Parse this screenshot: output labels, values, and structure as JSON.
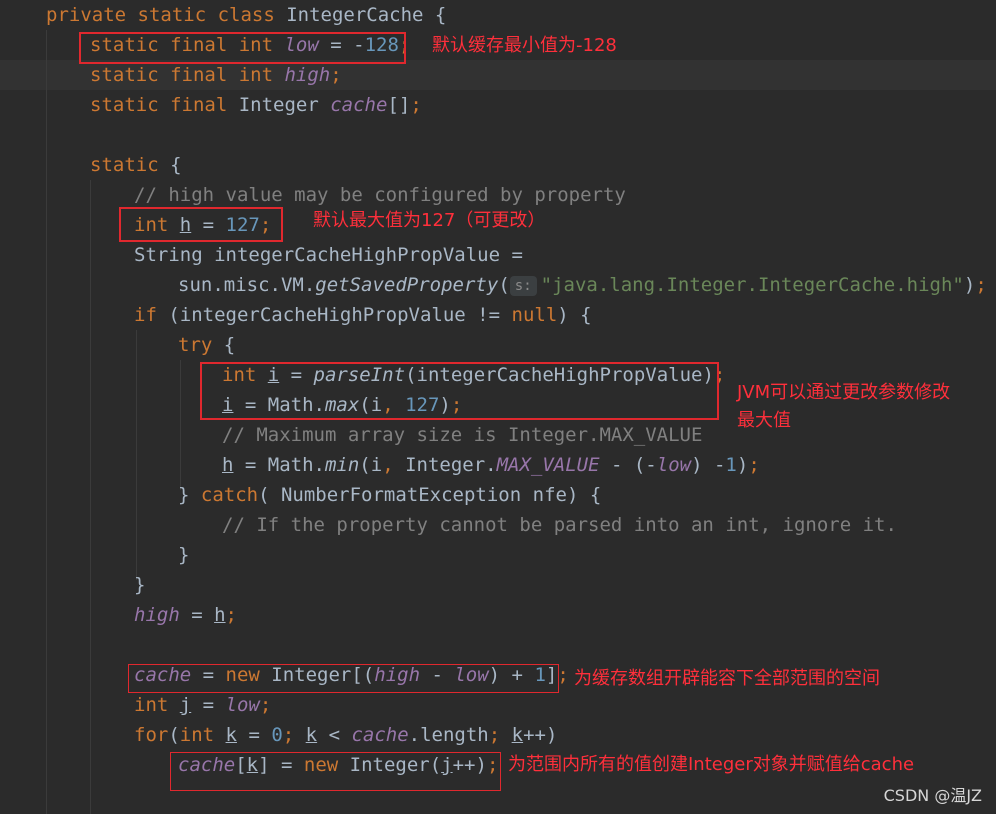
{
  "code": {
    "l1": {
      "kw": "private static class ",
      "cls": "IntegerCache {"
    },
    "l2": {
      "kw": "static final int ",
      "field": "low",
      "op": " = -",
      "num": "128",
      "semi": ";"
    },
    "l3": {
      "kw": "static final int ",
      "field": "high",
      "semi": ";"
    },
    "l4": {
      "kw": "static final ",
      "type": "Integer ",
      "field": "cache",
      "rest": "[]",
      "semi": ";"
    },
    "l6": {
      "kw": "static ",
      "rest": "{"
    },
    "l7": {
      "comment": "// high value may be configured by property"
    },
    "l8": {
      "kw": "int ",
      "var": "h",
      "op": " = ",
      "num": "127",
      "semi": ";"
    },
    "l9": {
      "text": "String integerCacheHighPropValue ="
    },
    "l10": {
      "pre": "sun.misc.VM.",
      "method": "getSavedProperty",
      "open": "(",
      "hint": "s:",
      "str": "\"java.lang.Integer.IntegerCache.high\"",
      "close": ")",
      "semi": ";"
    },
    "l11": {
      "kw": "if ",
      "pre": "(integerCacheHighPropValue != ",
      "kw2": "null",
      "rest": ") {"
    },
    "l12": {
      "kw": "try ",
      "rest": "{"
    },
    "l13": {
      "kw": "int ",
      "var": "i",
      "op": " = ",
      "method": "parseInt",
      "rest": "(integerCacheHighPropValue)",
      "semi": ";"
    },
    "l14": {
      "var": "i",
      "pre": " = Math.",
      "method": "max",
      "open": "(i",
      "comma": ", ",
      "num": "127",
      "close": ")",
      "semi": ";"
    },
    "l15": {
      "comment": "// Maximum array size is Integer.MAX_VALUE"
    },
    "l16": {
      "var": "h",
      "pre": " = Math.",
      "method": "min",
      "open": "(i",
      "comma": ", ",
      "pre2": "Integer.",
      "field": "MAX_VALUE",
      "mid": " - (-",
      "field2": "low",
      "mid2": ") -",
      "num": "1",
      "close": ")",
      "semi": ";"
    },
    "l17": {
      "pre": "} ",
      "kw": "catch",
      "rest": "( NumberFormatException nfe) {"
    },
    "l18": {
      "comment": "// If the property cannot be parsed into an int, ignore it."
    },
    "l19": {
      "text": "}"
    },
    "l20": {
      "text": "}"
    },
    "l21": {
      "field": "high",
      "op": " = ",
      "var": "h",
      "semi": ";"
    },
    "l23": {
      "field": "cache",
      "op": " = ",
      "kw": "new ",
      "pre": "Integer[(",
      "field2": "high",
      "mid": " - ",
      "field3": "low",
      "mid2": ") + ",
      "num": "1",
      "close": "]",
      "semi": ";"
    },
    "l24": {
      "kw": "int ",
      "var": "j",
      "op": " = ",
      "field": "low",
      "semi": ";"
    },
    "l25": {
      "kw": "for",
      "pre": "(",
      "kw2": "int ",
      "var": "k",
      "op": " = ",
      "num": "0",
      "semi": "; ",
      "var2": "k",
      "mid": " < ",
      "field": "cache",
      "mid2": ".length",
      "semi2": "; ",
      "var3": "k",
      "close": "++)"
    },
    "l26": {
      "field": "cache",
      "pre": "[",
      "var": "k",
      "mid": "] = ",
      "kw": "new ",
      "pre2": "Integer(",
      "var2": "j",
      "close": "++)",
      "semi": ";"
    }
  },
  "annotations": {
    "low": "默认缓存最小值为-128",
    "high": "默认最大值为127（可更改）",
    "jvm1": "JVM可以通过更改参数修改",
    "jvm2": "最大值",
    "array": "为缓存数组开辟能容下全部范围的空间",
    "create": "为范围内所有的值创建Integer对象并赋值给cache"
  },
  "watermark": "CSDN @温JZ",
  "colors": {
    "background": "#2b2b2b",
    "keyword": "#cc7832",
    "field": "#9876aa",
    "number": "#6897bb",
    "string": "#6a8759",
    "comment": "#808080",
    "annotation": "#ff2f3b"
  }
}
